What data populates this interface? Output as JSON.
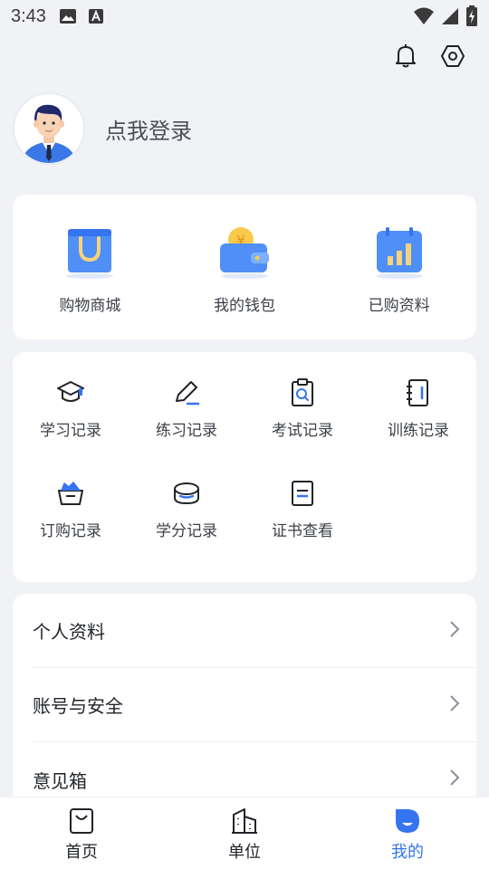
{
  "status_bar": {
    "time": "3:43",
    "icons": [
      "image-icon",
      "font-a-icon",
      "wifi-icon",
      "signal-icon",
      "battery-charging-icon"
    ]
  },
  "top_actions": [
    "bell-icon",
    "settings-hexagon-icon"
  ],
  "profile": {
    "login_text": "点我登录",
    "avatar": "user-avatar"
  },
  "shop_card": {
    "items": [
      {
        "label": "购物商城",
        "icon": "shopping-bag-icon"
      },
      {
        "label": "我的钱包",
        "icon": "wallet-icon"
      },
      {
        "label": "已购资料",
        "icon": "calendar-chart-icon"
      }
    ]
  },
  "records_card": {
    "items": [
      {
        "label": "学习记录",
        "icon": "graduation-cap-icon"
      },
      {
        "label": "练习记录",
        "icon": "pencil-icon"
      },
      {
        "label": "考试记录",
        "icon": "clipboard-search-icon"
      },
      {
        "label": "训练记录",
        "icon": "notebook-icon"
      },
      {
        "label": "订购记录",
        "icon": "basket-icon"
      },
      {
        "label": "学分记录",
        "icon": "coins-icon"
      },
      {
        "label": "证书查看",
        "icon": "certificate-icon"
      }
    ]
  },
  "menu": {
    "items": [
      {
        "label": "个人资料"
      },
      {
        "label": "账号与安全"
      },
      {
        "label": "意见箱"
      }
    ]
  },
  "tab_bar": {
    "tabs": [
      {
        "label": "首页",
        "icon": "bag-icon"
      },
      {
        "label": "单位",
        "icon": "building-icon"
      },
      {
        "label": "我的",
        "icon": "profile-icon",
        "active": true
      }
    ]
  },
  "colors": {
    "accent": "#3574f0",
    "background": "#f1f2f6",
    "card": "#ffffff"
  }
}
